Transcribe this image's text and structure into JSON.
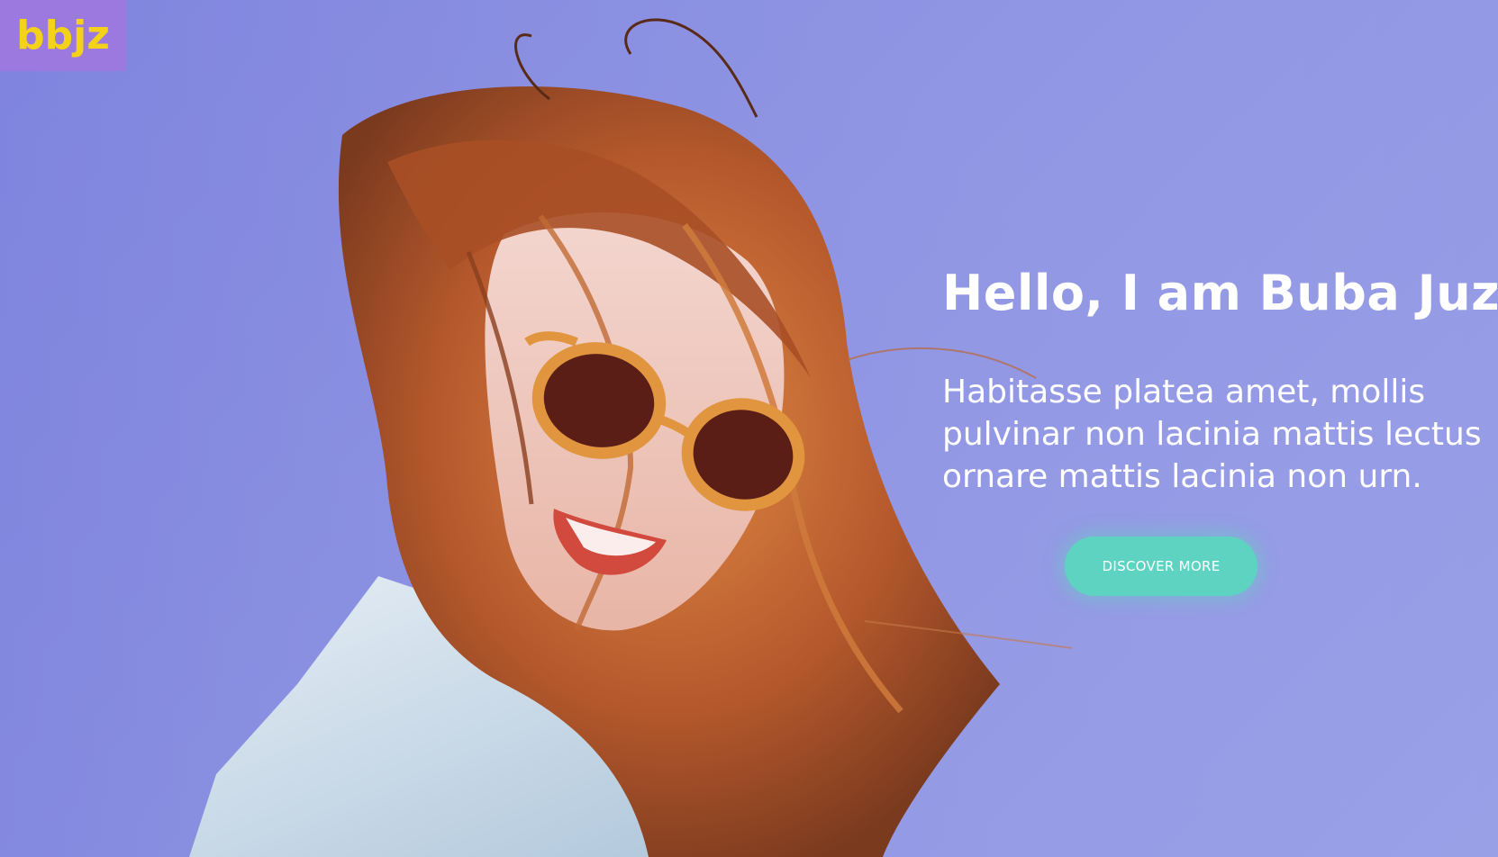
{
  "brand": {
    "logo_text": "bbjz",
    "logo_bg": "#9b79df",
    "logo_color": "#f5d21a"
  },
  "hero": {
    "headline": "Hello, I am Buba Juz.",
    "description": "Habitasse platea amet, mollis pulvinar non lacinia mattis lectus ornare mattis lacinia non urn.",
    "cta_label": "DISCOVER MORE",
    "cta_color": "#5fd3c1",
    "background_color": "#8f95e3",
    "photo": "hero-photo-woman-with-sunglasses"
  }
}
